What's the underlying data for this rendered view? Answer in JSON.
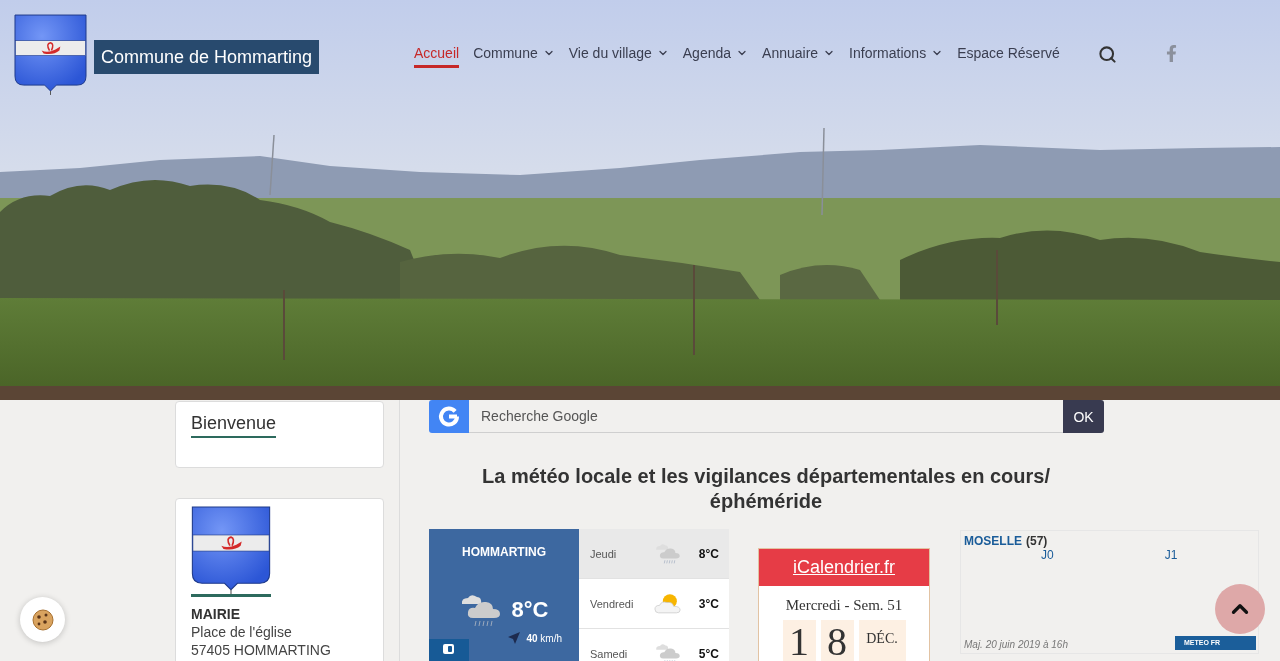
{
  "header": {
    "site_title": "Commune de Hommarting",
    "nav": [
      {
        "label": "Accueil",
        "selected": true,
        "has_submenu": false
      },
      {
        "label": "Commune",
        "selected": false,
        "has_submenu": true
      },
      {
        "label": "Vie du village",
        "selected": false,
        "has_submenu": true
      },
      {
        "label": "Agenda",
        "selected": false,
        "has_submenu": true
      },
      {
        "label": "Annuaire",
        "selected": false,
        "has_submenu": true
      },
      {
        "label": "Informations",
        "selected": false,
        "has_submenu": true
      },
      {
        "label": "Espace Réservé",
        "selected": false,
        "has_submenu": false
      }
    ]
  },
  "sidebar": {
    "cards": [
      {
        "kind": "heading",
        "title": "Bienvenue"
      },
      {
        "kind": "address",
        "title": "MAIRIE",
        "lines": [
          "Place de l'église",
          "57405 HOMMARTING"
        ]
      }
    ]
  },
  "search": {
    "placeholder": "Recherche Google",
    "button": "OK"
  },
  "section_title": "La météo locale et les vigilances départementales en cours/ éphéméride",
  "weather": {
    "city": "HOMMARTING",
    "temperature": "8°C",
    "wind": "**40** km/h",
    "forecast": [
      {
        "day": "Jeudi",
        "kind": "rain",
        "temperature": "8°C",
        "selected": true
      },
      {
        "day": "Vendredi",
        "kind": "sun-cloud",
        "temperature": "3°C",
        "selected": false
      },
      {
        "day": "Samedi",
        "kind": "rain",
        "temperature": "5°C",
        "selected": false
      }
    ]
  },
  "calendar": {
    "link": "iCalendrier.fr",
    "weekday_week": "Mercredi - Sem. 51",
    "day_digits": [
      "1",
      "8"
    ],
    "month": "DÉC."
  },
  "vigilance": {
    "department": "MOSELLE",
    "code": "(57)",
    "columns": [
      "J0",
      "J1"
    ],
    "updated": "Maj. 20 juin 2019 à 16h",
    "badge": "METEO FR"
  }
}
